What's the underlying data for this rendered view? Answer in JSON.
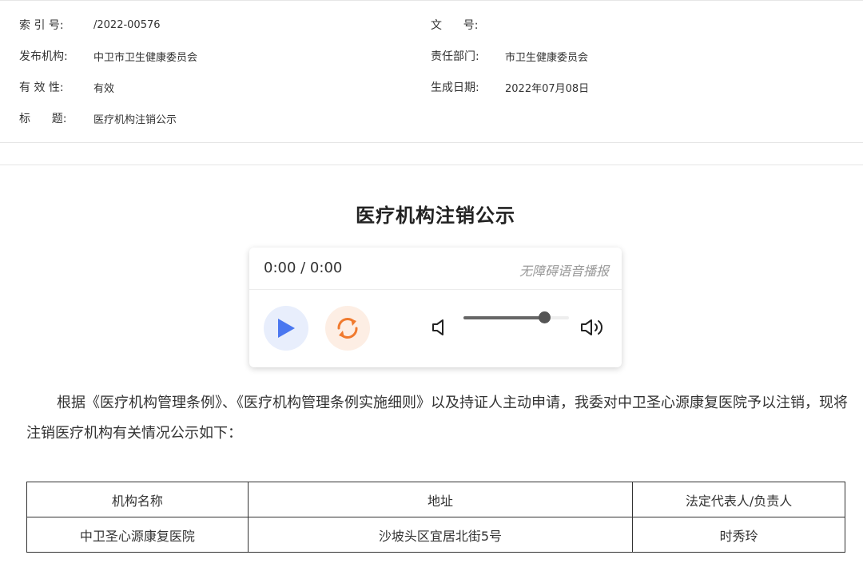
{
  "meta": {
    "index_label": "索 引 号:",
    "index_value": "/2022-00576",
    "doc_no_label": "文      号:",
    "doc_no_value": "",
    "publisher_label": "发布机构:",
    "publisher_value": "中卫市卫生健康委员会",
    "dept_label": "责任部门:",
    "dept_value": "市卫生健康委员会",
    "validity_label": "有 效 性:",
    "validity_value": "有效",
    "date_label": "生成日期:",
    "date_value": "2022年07月08日",
    "title_label": "标      题:",
    "title_value": "医疗机构注销公示"
  },
  "article": {
    "title": "医疗机构注销公示",
    "paragraph": "根据《医疗机构管理条例》、《医疗机构管理条例实施细则》以及持证人主动申请，我委对中卫圣心源康复医院予以注销，现将注销医疗机构有关情况公示如下："
  },
  "player": {
    "time": "0:00 / 0:00",
    "a11y_label": "无障碍语音播报",
    "volume": 0.77,
    "colors": {
      "play": "#4a77f0",
      "loop": "#f07a2e"
    }
  },
  "table": {
    "headers": [
      "机构名称",
      "地址",
      "法定代表人/负责人"
    ],
    "rows": [
      [
        "中卫圣心源康复医院",
        "沙坡头区宜居北街5号",
        "时秀玲"
      ]
    ]
  }
}
